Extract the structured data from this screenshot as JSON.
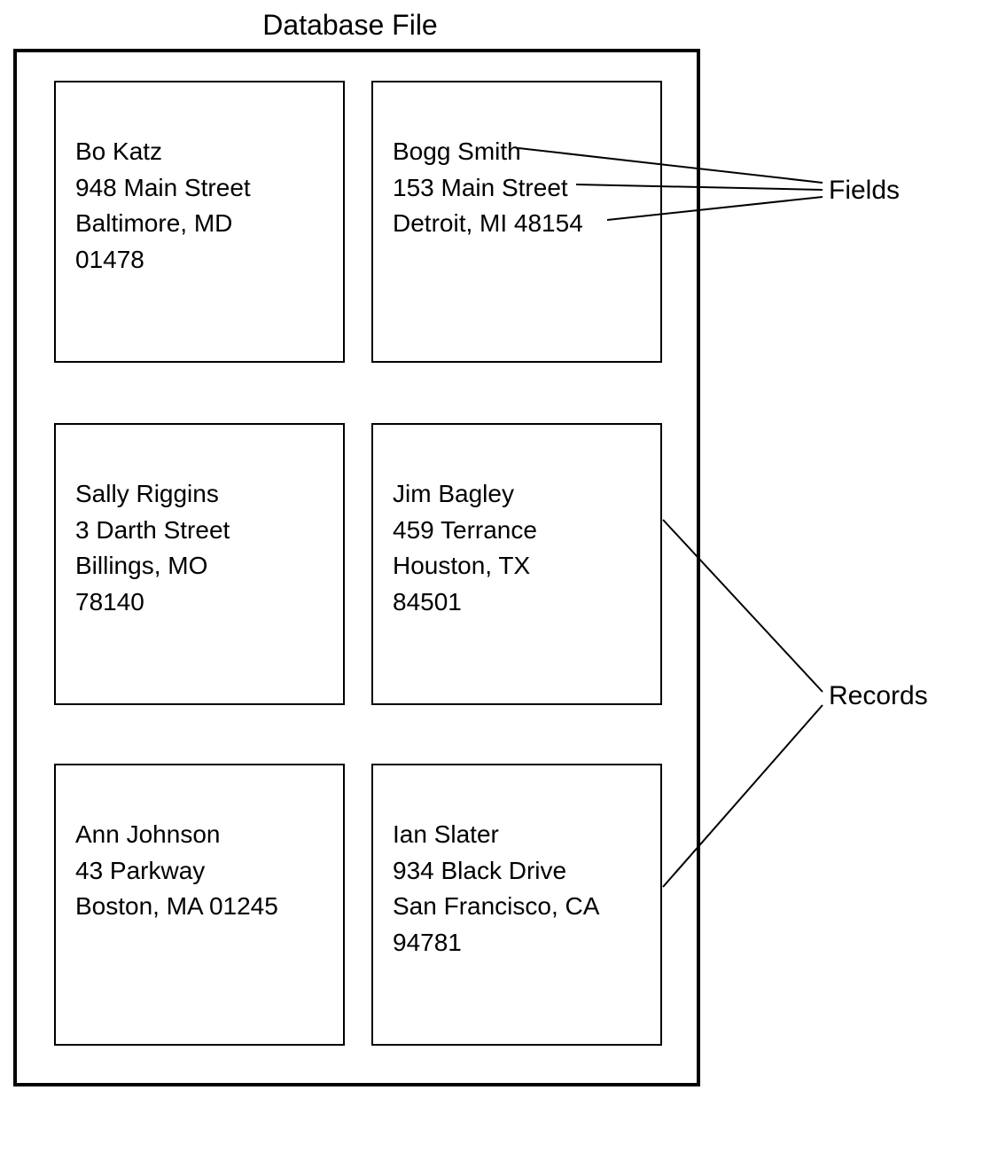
{
  "title": "Database File",
  "labels": {
    "fields": "Fields",
    "records": "Records"
  },
  "records": [
    {
      "name": "Bo Katz",
      "street": "948 Main Street",
      "city_state": "Baltimore, MD",
      "zip": "01478"
    },
    {
      "name": "Bogg Smith",
      "street": "153 Main Street",
      "city_state": "Detroit, MI 48154",
      "zip": ""
    },
    {
      "name": "Sally Riggins",
      "street": "3 Darth Street",
      "city_state": "Billings, MO",
      "zip": "78140"
    },
    {
      "name": "Jim Bagley",
      "street": "459 Terrance",
      "city_state": "Houston, TX",
      "zip": "84501"
    },
    {
      "name": "Ann Johnson",
      "street": "43 Parkway",
      "city_state": "Boston, MA 01245",
      "zip": ""
    },
    {
      "name": "Ian Slater",
      "street": "934 Black Drive",
      "city_state": "San Francisco, CA",
      "zip": "94781"
    }
  ]
}
